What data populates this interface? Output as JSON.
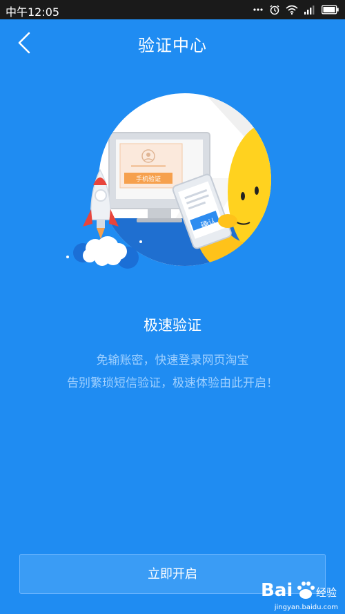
{
  "status_bar": {
    "time": "中午12:05"
  },
  "header": {
    "title": "验证中心"
  },
  "illustration": {
    "screen_button_label": "手机验证",
    "phone_button_label": "确认"
  },
  "feature": {
    "title": "极速验证",
    "description_line1": "免输账密，快速登录网页淘宝",
    "description_line2": "告别繁琐短信验证，极速体验由此开启！"
  },
  "actions": {
    "enable_label": "立即开启"
  },
  "watermark": {
    "brand_text": "Bai 经验",
    "url": "jingyan.baidu.com"
  },
  "colors": {
    "background": "#1f8cf2",
    "status_bar": "#1a1a1a",
    "button_border": "#6db6ff",
    "description_text": "#9fd0ff",
    "illustration_accent": "#f6a04d",
    "mascot_yellow": "#ffd21f"
  },
  "icons": [
    "back-icon",
    "more-icon",
    "alarm-icon",
    "wifi-icon",
    "signal-icon",
    "battery-icon"
  ]
}
